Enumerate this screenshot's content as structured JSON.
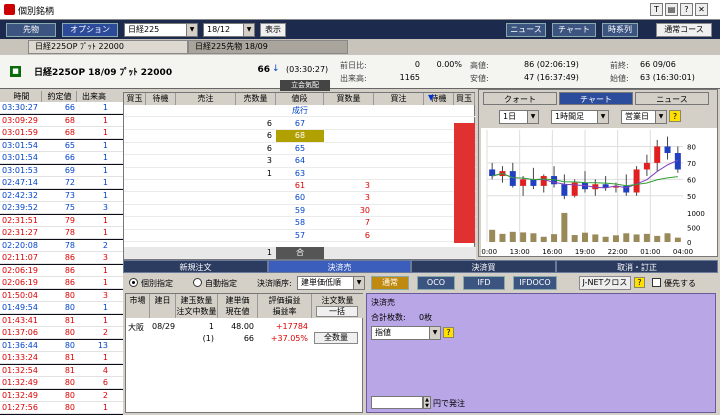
{
  "window": {
    "title": "個別銘柄"
  },
  "toolbar": {
    "tab1": "先物",
    "tab2": "オプション",
    "underlying": "日経225",
    "month": "18/12",
    "show": "表示",
    "news": "ニュース",
    "chart": "チャート",
    "timeseries": "時系列",
    "course": "通常コース"
  },
  "tabs": [
    "日経225OP ﾌﾟｯﾄ 22000",
    "日経225先物 18/09"
  ],
  "header": {
    "name": "日経225OP 18/09 ﾌﾟｯﾄ 22000",
    "price": "66",
    "arrow": "↓",
    "time": "(03:30:27)",
    "note": "立会気配"
  },
  "stats": {
    "chg_label": "前日比:",
    "chg": "0",
    "chg_pct": "0.00%",
    "high_label": "高値:",
    "high": "86 (02:06:19)",
    "prev_label": "前終:",
    "prev": "66 09/06",
    "vol_label": "出来高:",
    "vol": "1165",
    "low_label": "安値:",
    "low": "47 (16:37:49)",
    "open_label": "始値:",
    "open": "63 (16:30:01)"
  },
  "ticks": {
    "headers": [
      "時間",
      "約定値",
      "出来高"
    ],
    "rows": [
      [
        "03:30:27",
        "66",
        "1"
      ],
      [
        "03:09:29",
        "68",
        "1"
      ],
      [
        "03:01:59",
        "68",
        "1"
      ],
      [
        "03:01:54",
        "65",
        "1"
      ],
      [
        "03:01:54",
        "66",
        "1"
      ],
      [
        "03:01:53",
        "69",
        "1"
      ],
      [
        "02:47:14",
        "72",
        "1"
      ],
      [
        "02:42:32",
        "73",
        "1"
      ],
      [
        "02:39:52",
        "75",
        "3"
      ],
      [
        "02:31:51",
        "79",
        "1"
      ],
      [
        "02:31:27",
        "78",
        "1"
      ],
      [
        "02:20:08",
        "78",
        "2"
      ],
      [
        "02:11:07",
        "86",
        "3"
      ],
      [
        "02:06:19",
        "86",
        "1"
      ],
      [
        "02:06:19",
        "86",
        "1"
      ],
      [
        "01:50:04",
        "80",
        "3"
      ],
      [
        "01:49:54",
        "80",
        "1"
      ],
      [
        "01:43:41",
        "81",
        "1"
      ],
      [
        "01:37:06",
        "80",
        "2"
      ],
      [
        "01:36:44",
        "80",
        "13"
      ],
      [
        "01:33:24",
        "81",
        "1"
      ],
      [
        "01:32:54",
        "81",
        "4"
      ],
      [
        "01:32:49",
        "80",
        "6"
      ],
      [
        "01:32:49",
        "80",
        "2"
      ],
      [
        "01:27:56",
        "80",
        "1"
      ]
    ]
  },
  "board": {
    "headers": [
      "買玉",
      "待機",
      "売注",
      "売数量",
      "値段",
      "買数量",
      "買注",
      "待機",
      "買玉"
    ],
    "market": "成行",
    "rows": [
      {
        "sq": "6",
        "price": "67",
        "bq": "",
        "pc": "blue"
      },
      {
        "sq": "6",
        "price": "68",
        "bq": "",
        "pc": "hl"
      },
      {
        "sq": "6",
        "price": "65",
        "bq": "",
        "pc": "blue"
      },
      {
        "sq": "3",
        "price": "64",
        "bq": "",
        "pc": "blue"
      },
      {
        "sq": "1",
        "price": "63",
        "bq": "",
        "pc": "blue"
      },
      {
        "sq": "",
        "price": "61",
        "bq": "3",
        "pc": "red"
      },
      {
        "sq": "",
        "price": "60",
        "bq": "3",
        "pc": "blue"
      },
      {
        "sq": "",
        "price": "59",
        "bq": "30",
        "pc": "blue"
      },
      {
        "sq": "",
        "price": "58",
        "bq": "7",
        "pc": "blue"
      },
      {
        "sq": "",
        "price": "57",
        "bq": "6",
        "pc": "blue"
      },
      {
        "sq": "",
        "price": "-",
        "bq": "",
        "pc": "blue"
      }
    ],
    "total_sell": "1",
    "total_label": "合"
  },
  "chart": {
    "tabs": [
      "クォート",
      "チャート",
      "ニュース"
    ],
    "period": "1日",
    "interval": "1時間足",
    "bar_type": "営業日",
    "xticks": [
      "10:00",
      "13:00",
      "16:00",
      "19:00",
      "22:00",
      "01:00",
      "04:00"
    ],
    "yticks": [
      "80",
      "70",
      "60",
      "50"
    ],
    "vticks": [
      "1000",
      "500",
      "0"
    ]
  },
  "chart_data": {
    "type": "candlestick",
    "x": [
      "09:00",
      "10:00",
      "11:00",
      "12:00",
      "13:00",
      "14:00",
      "15:00",
      "16:00",
      "17:00",
      "18:00",
      "19:00",
      "20:00",
      "21:00",
      "22:00",
      "23:00",
      "00:00",
      "01:00",
      "02:00",
      "03:00"
    ],
    "ohlc": [
      [
        66,
        70,
        60,
        62
      ],
      [
        62,
        68,
        58,
        65
      ],
      [
        65,
        70,
        55,
        56
      ],
      [
        56,
        62,
        50,
        60
      ],
      [
        60,
        67,
        54,
        56
      ],
      [
        56,
        63,
        52,
        62
      ],
      [
        62,
        68,
        55,
        57
      ],
      [
        57,
        63,
        48,
        50
      ],
      [
        50,
        60,
        49,
        58
      ],
      [
        58,
        65,
        52,
        54
      ],
      [
        54,
        60,
        50,
        57
      ],
      [
        57,
        62,
        53,
        55
      ],
      [
        55,
        58,
        52,
        56
      ],
      [
        56,
        63,
        50,
        52
      ],
      [
        52,
        68,
        50,
        66
      ],
      [
        66,
        75,
        62,
        70
      ],
      [
        70,
        84,
        65,
        80
      ],
      [
        80,
        86,
        72,
        76
      ],
      [
        76,
        80,
        64,
        66
      ]
    ],
    "volume": [
      420,
      280,
      350,
      330,
      300,
      180,
      270,
      1000,
      240,
      320,
      260,
      180,
      230,
      300,
      260,
      280,
      210,
      300,
      150
    ],
    "ylim": [
      45,
      90
    ],
    "vlim": [
      0,
      1100
    ]
  },
  "order": {
    "tabs": [
      "新規注文",
      "決済売",
      "決済買",
      "取消・訂正"
    ],
    "radio1": "個別指定",
    "radio2": "自動指定",
    "sort_label": "決済順序:",
    "sort": "建単価低順",
    "modes": [
      "通常",
      "OCO",
      "IFD",
      "IFDOCO"
    ],
    "jnet": "J-NETクロス",
    "priority": "優先する"
  },
  "positions": {
    "headers": [
      "市場",
      "建日",
      "建玉数量\n注文中数量",
      "建単価\n現在値",
      "評価損益\n損益率",
      "注文数量"
    ],
    "bulk": "一括",
    "all": "全数量",
    "row": {
      "market": "大阪",
      "date": "08/29",
      "qty": "1",
      "qty2": "(1)",
      "cost": "48.00",
      "cur": "66",
      "pnl": "+17784",
      "rate": "+37.05%"
    }
  },
  "settle": {
    "title": "決済売",
    "total_label": "合計枚数:",
    "total": "0枚",
    "price_type": "指値",
    "order_suffix": "円で発注"
  }
}
